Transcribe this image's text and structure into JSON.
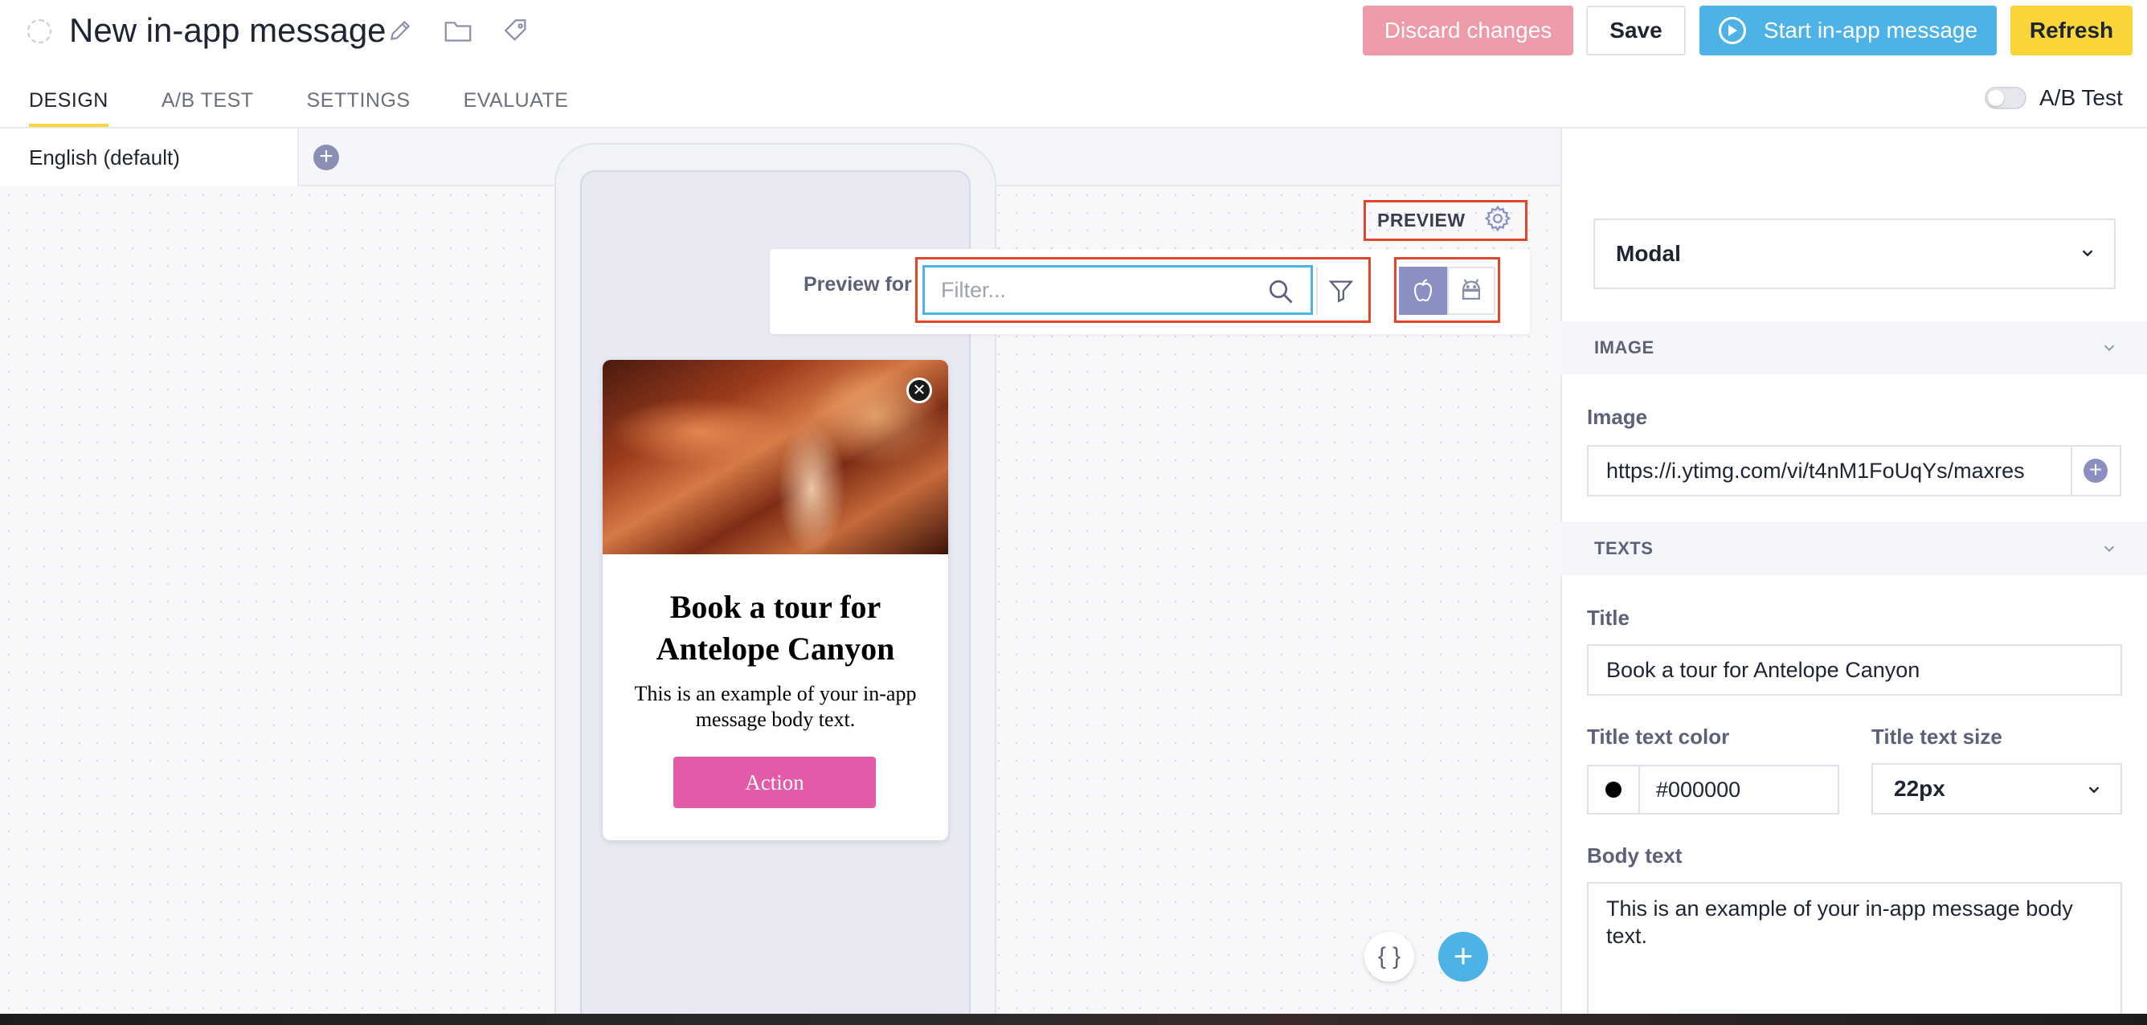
{
  "header": {
    "title": "New in-app message",
    "discard_label": "Discard changes",
    "save_label": "Save",
    "start_label": "Start in-app message",
    "refresh_label": "Refresh",
    "ab_toggle_label": "A/B Test",
    "ab_toggle_on": false
  },
  "tabs": [
    {
      "label": "DESIGN",
      "active": true
    },
    {
      "label": "A/B TEST",
      "active": false
    },
    {
      "label": "SETTINGS",
      "active": false
    },
    {
      "label": "EVALUATE",
      "active": false
    }
  ],
  "language": {
    "current": "English (default)"
  },
  "preview": {
    "label": "PREVIEW",
    "preview_for_label": "Preview for",
    "filter_placeholder": "Filter...",
    "selected_os": "ios"
  },
  "message": {
    "title": "Book a tour for Antelope Canyon",
    "body": "This is an example of your in-app message body text.",
    "action_label": "Action"
  },
  "settings": {
    "type": "Modal",
    "image_section": "IMAGE",
    "image_label": "Image",
    "image_url": "https://i.ytimg.com/vi/t4nM1FoUqYs/maxres",
    "texts_section": "TEXTS",
    "title_label": "Title",
    "title_value": "Book a tour for Antelope Canyon",
    "title_color_label": "Title text color",
    "title_color_value": "#000000",
    "title_size_label": "Title text size",
    "title_size_value": "22px",
    "body_label": "Body text",
    "body_value": "This is an example of your in-app message body text."
  },
  "colors": {
    "accent_blue": "#4db3e6",
    "discard_pink": "#ee9aa8",
    "refresh_yellow": "#f9d53a",
    "action_pink": "#e25aa8",
    "highlight_red": "#e2452a"
  }
}
